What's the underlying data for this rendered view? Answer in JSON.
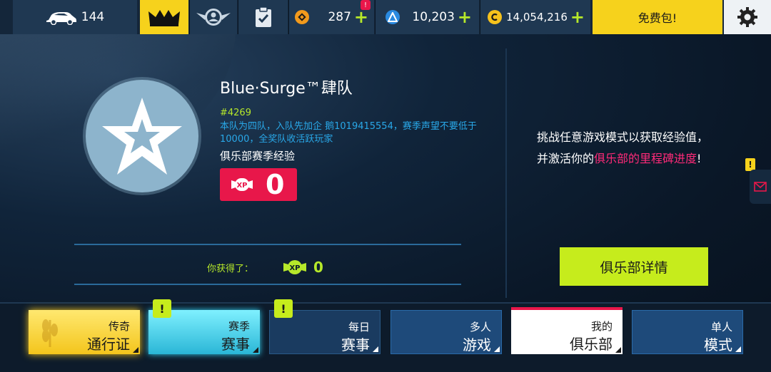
{
  "topbar": {
    "cars_count": "144",
    "currency_orange": "287",
    "currency_orange_badge": "!",
    "currency_blue": "10,203",
    "credits": "14,054,216",
    "free_pack_label": "免费包!",
    "plus_symbol": "+",
    "icons": [
      "car-icon",
      "crown-icon",
      "badge-wings-icon",
      "clipboard-check-icon",
      "orange-token-icon",
      "blue-token-icon",
      "credits-coin-icon",
      "gear-icon"
    ]
  },
  "club": {
    "name": "Blue·Surge™肆队",
    "tag": "#4269",
    "description": "本队为四队，入队先加企 鹅1019415554，赛季声望不要低于10000，全奖队收活跃玩家",
    "season_xp_label": "俱乐部赛季经验",
    "season_xp_value": "0",
    "earned_label": "你获得了：",
    "earned_value": "0",
    "xp_badge_text": "XP"
  },
  "right_panel": {
    "text_line1": "挑战任意游戏模式以获取经验值，",
    "text_line2_a": "并激活你的",
    "text_line2_b": "俱乐部的里程碑进度",
    "text_line2_c": "!",
    "details_button": "俱乐部详情",
    "side_badge": "!"
  },
  "bottom_nav": {
    "legend_pass": {
      "line1": "传奇",
      "line2": "通行证"
    },
    "season_events": {
      "line1": "赛季",
      "line2": "赛事",
      "badge": "!"
    },
    "daily_events": {
      "line1": "每日",
      "line2": "赛事",
      "badge": "!"
    },
    "multiplayer": {
      "line1": "多人",
      "line2": "游戏"
    },
    "my_club": {
      "line1": "我的",
      "line2": "俱乐部"
    },
    "single_mode": {
      "line1": "单人",
      "line2": "模式"
    }
  },
  "colors": {
    "accent_green": "#b6e82a",
    "accent_pink": "#e8174a",
    "accent_yellow": "#f6d21c",
    "accent_cyan": "#29a8e8"
  }
}
